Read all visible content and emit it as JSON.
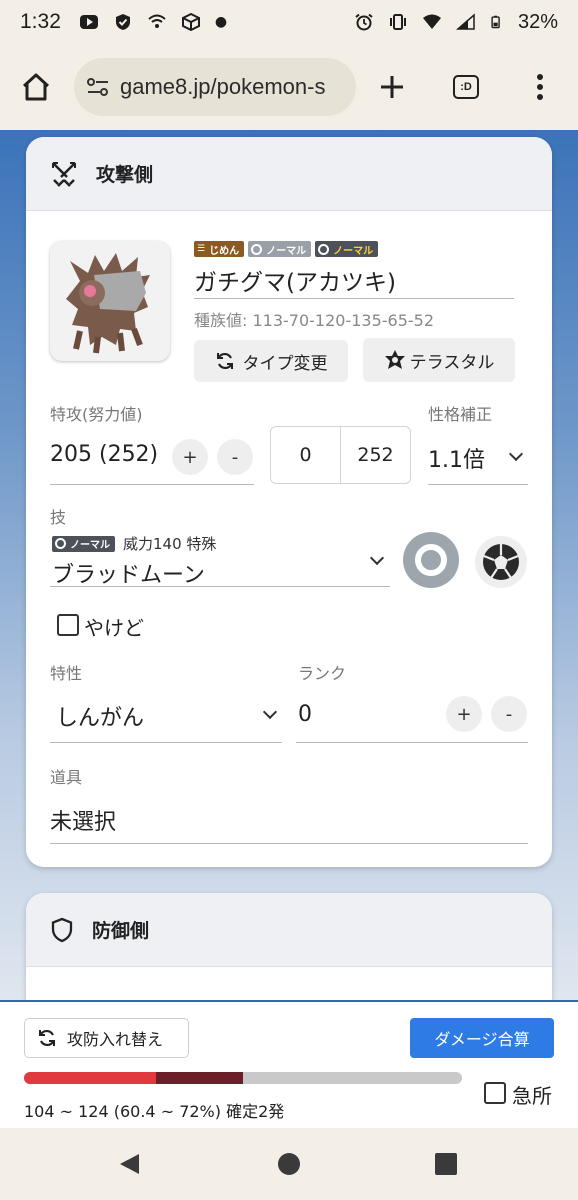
{
  "status": {
    "time": "1:32",
    "battery": "32%"
  },
  "browser": {
    "url": "game8.jp/pokemon-s",
    "tab_label": ":D"
  },
  "attacker": {
    "title": "攻撃側",
    "badges": [
      "じめん",
      "ノーマル",
      "ノーマル"
    ],
    "pokemon_name": "ガチグマ(アカツキ)",
    "base_stats": "種族値: 113-70-120-135-65-52",
    "type_change_label": "タイプ変更",
    "terastal_label": "テラスタル",
    "stat_label": "特攻(努力値)",
    "stat_value": "205 (252)",
    "plus": "+",
    "minus": "-",
    "ev_min": "0",
    "ev_max": "252",
    "nature_label": "性格補正",
    "nature_value": "1.1倍",
    "move_label": "技",
    "move_badge": "ノーマル",
    "move_meta": "威力140 特殊",
    "move_name": "ブラッドムーン",
    "burn_label": "やけど",
    "ability_label": "特性",
    "ability_value": "しんがん",
    "rank_label": "ランク",
    "rank_value": "0",
    "item_label": "道具",
    "item_value": "未選択"
  },
  "defender": {
    "title": "防御側"
  },
  "bottom": {
    "swap_label": "攻防入れ替え",
    "calc_label": "ダメージ合算",
    "result": "104 ~ 124 (60.4 ~ 72%) 確定2発",
    "crit_label": "急所",
    "damage_min_pct": 60.4,
    "damage_max_pct": 72
  },
  "colors": {
    "accent": "#2f7be6",
    "bar_red": "#e0393e",
    "bar_dark": "#6b1f28",
    "ground": "#8b5a22"
  }
}
